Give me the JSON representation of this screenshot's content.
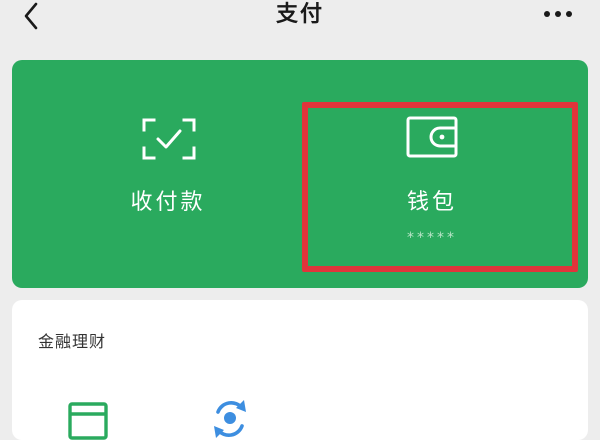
{
  "header": {
    "title": "支付",
    "back_icon": "chevron-left-icon",
    "more_icon": "more-dots-icon"
  },
  "panel": {
    "color": "#2aaa5e",
    "pay": {
      "label": "收付款",
      "icon": "scan-check-icon"
    },
    "wallet": {
      "label": "钱包",
      "balance": "*****",
      "icon": "wallet-icon"
    },
    "highlight_color": "#e0353b"
  },
  "finance": {
    "title": "金融理财",
    "icons": [
      "card-icon",
      "refresh-coin-icon"
    ]
  }
}
